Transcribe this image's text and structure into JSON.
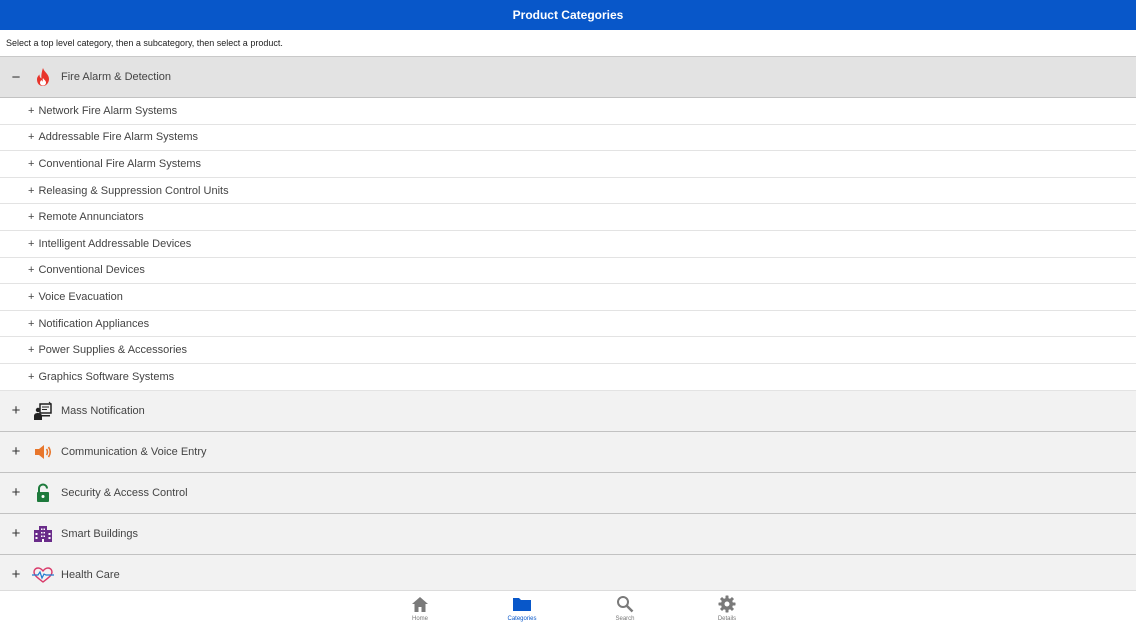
{
  "header": {
    "title": "Product Categories"
  },
  "instructions": "Select a top level category, then a subcategory, then select a product.",
  "categories": [
    {
      "label": "Fire Alarm & Detection",
      "toggle": "−",
      "icon": "flame-icon",
      "expanded": true,
      "subcategories": [
        "Network Fire Alarm Systems",
        "Addressable Fire Alarm Systems",
        "Conventional Fire Alarm Systems",
        "Releasing & Suppression Control Units",
        "Remote Annunciators",
        "Intelligent Addressable Devices",
        "Conventional Devices",
        "Voice Evacuation",
        "Notification Appliances",
        "Power Supplies & Accessories",
        "Graphics Software Systems"
      ]
    },
    {
      "label": "Mass Notification",
      "toggle": "+",
      "icon": "presenter-screen-icon",
      "expanded": false
    },
    {
      "label": "Communication & Voice Entry",
      "toggle": "+",
      "icon": "speaker-icon",
      "expanded": false
    },
    {
      "label": "Security & Access Control",
      "toggle": "+",
      "icon": "padlock-icon",
      "expanded": false
    },
    {
      "label": "Smart Buildings",
      "toggle": "+",
      "icon": "building-icon",
      "expanded": false
    },
    {
      "label": "Health Care",
      "toggle": "+",
      "icon": "heart-pulse-icon",
      "expanded": false
    }
  ],
  "sub_prefix": "+",
  "tabs": [
    {
      "label": "Home",
      "icon": "home-icon",
      "active": false
    },
    {
      "label": "Categories",
      "icon": "folder-icon",
      "active": true
    },
    {
      "label": "Search",
      "icon": "search-icon",
      "active": false
    },
    {
      "label": "Details",
      "icon": "gear-icon",
      "active": false
    }
  ],
  "colors": {
    "header": "#0857c9",
    "flame": "#e8342b",
    "speaker": "#e8762b",
    "padlock": "#1e7a3c",
    "building": "#6a2c8a",
    "heart": "#d93a6a",
    "tab_inactive": "#7a7a7a",
    "tab_active": "#0857c9"
  }
}
